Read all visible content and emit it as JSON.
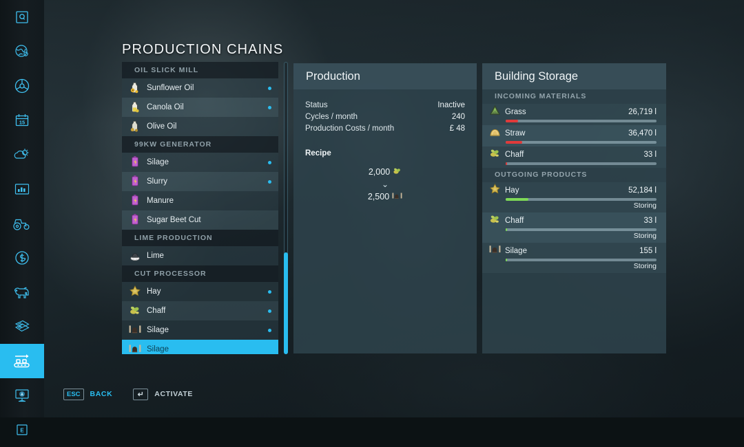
{
  "page_title": "PRODUCTION CHAINS",
  "accent": "#29bdf0",
  "rail": {
    "items": [
      {
        "name": "quest-icon",
        "label": "Q"
      },
      {
        "name": "globe-map-icon",
        "label": ""
      },
      {
        "name": "steering-wheel-icon",
        "label": ""
      },
      {
        "name": "calendar-icon",
        "label": "15"
      },
      {
        "name": "weather-icon",
        "label": ""
      },
      {
        "name": "statistics-icon",
        "label": ""
      },
      {
        "name": "vehicles-icon",
        "label": ""
      },
      {
        "name": "finances-icon",
        "label": ""
      },
      {
        "name": "animals-icon",
        "label": ""
      },
      {
        "name": "contracts-icon",
        "label": ""
      },
      {
        "name": "production-chains-icon",
        "label": ""
      },
      {
        "name": "construction-icon",
        "label": ""
      },
      {
        "name": "exit-icon",
        "label": "E"
      }
    ],
    "active_index": 10
  },
  "chain_list": [
    {
      "type": "group",
      "label": "OIL SLICK MILL"
    },
    {
      "type": "item",
      "label": "Sunflower Oil",
      "icon": "sunflower-oil-icon",
      "active": true,
      "selected": false,
      "shade": "dark"
    },
    {
      "type": "item",
      "label": "Canola Oil",
      "icon": "canola-oil-icon",
      "active": true,
      "selected": false,
      "shade": "light"
    },
    {
      "type": "item",
      "label": "Olive Oil",
      "icon": "olive-oil-icon",
      "active": false,
      "selected": false,
      "shade": "dark"
    },
    {
      "type": "group",
      "label": "99KW GENERATOR"
    },
    {
      "type": "item",
      "label": "Silage",
      "icon": "generator-canister-icon",
      "active": true,
      "selected": false,
      "shade": "dark"
    },
    {
      "type": "item",
      "label": "Slurry",
      "icon": "generator-canister-icon",
      "active": true,
      "selected": false,
      "shade": "light"
    },
    {
      "type": "item",
      "label": "Manure",
      "icon": "generator-canister-icon",
      "active": false,
      "selected": false,
      "shade": "dark"
    },
    {
      "type": "item",
      "label": "Sugar Beet Cut",
      "icon": "generator-canister-icon",
      "active": false,
      "selected": false,
      "shade": "light"
    },
    {
      "type": "group",
      "label": "LIME PRODUCTION"
    },
    {
      "type": "item",
      "label": "Lime",
      "icon": "lime-icon",
      "active": false,
      "selected": false,
      "shade": "dark"
    },
    {
      "type": "group",
      "label": "CUT PROCESSOR"
    },
    {
      "type": "item",
      "label": "Hay",
      "icon": "hay-icon",
      "active": true,
      "selected": false,
      "shade": "dark"
    },
    {
      "type": "item",
      "label": "Chaff",
      "icon": "chaff-icon",
      "active": true,
      "selected": false,
      "shade": "light"
    },
    {
      "type": "item",
      "label": "Silage",
      "icon": "silage-bale-icon",
      "active": true,
      "selected": false,
      "shade": "dark"
    },
    {
      "type": "item",
      "label": "Silage",
      "icon": "silage-bale-icon",
      "active": false,
      "selected": true,
      "shade": "sel"
    }
  ],
  "scrollbar": {
    "name": "chain-list-scrollbar"
  },
  "production": {
    "title": "Production",
    "rows": [
      {
        "key": "Status",
        "value": "Inactive"
      },
      {
        "key": "Cycles / month",
        "value": "240"
      },
      {
        "key": "Production Costs / month",
        "value": "£ 48"
      }
    ],
    "recipe_label": "Recipe",
    "recipe": {
      "input_amount": "2,000",
      "input_icon": "chaff-icon",
      "arrow": "⌄",
      "output_amount": "2,500",
      "output_icon": "silage-bale-icon"
    }
  },
  "storage": {
    "title": "Building Storage",
    "groups": [
      {
        "label": "INCOMING MATERIALS",
        "rows": [
          {
            "name": "Grass",
            "icon": "grass-icon",
            "amount": "26,719 l",
            "fill_pct": 8,
            "fill_color": "#e03a3a",
            "status": "",
            "shade": "dark"
          },
          {
            "name": "Straw",
            "icon": "straw-icon",
            "amount": "36,470 l",
            "fill_pct": 11,
            "fill_color": "#e03a3a",
            "status": "",
            "shade": "light"
          },
          {
            "name": "Chaff",
            "icon": "chaff-icon",
            "amount": "33 l",
            "fill_pct": 1,
            "fill_color": "#e03a3a",
            "status": "",
            "shade": "dark"
          }
        ]
      },
      {
        "label": "OUTGOING PRODUCTS",
        "rows": [
          {
            "name": "Hay",
            "icon": "hay-icon",
            "amount": "52,184 l",
            "fill_pct": 15,
            "fill_color": "#7ed957",
            "status": "Storing",
            "shade": "dark"
          },
          {
            "name": "Chaff",
            "icon": "chaff-icon",
            "amount": "33 l",
            "fill_pct": 1,
            "fill_color": "#7ed957",
            "status": "Storing",
            "shade": "light"
          },
          {
            "name": "Silage",
            "icon": "silage-bale-icon",
            "amount": "155 l",
            "fill_pct": 1,
            "fill_color": "#7ed957",
            "status": "Storing",
            "shade": "dark"
          }
        ]
      }
    ]
  },
  "help_bar": [
    {
      "key": "ESC",
      "label": "BACK",
      "highlight": true
    },
    {
      "key": "↵",
      "label": "ACTIVATE",
      "highlight": false
    }
  ]
}
